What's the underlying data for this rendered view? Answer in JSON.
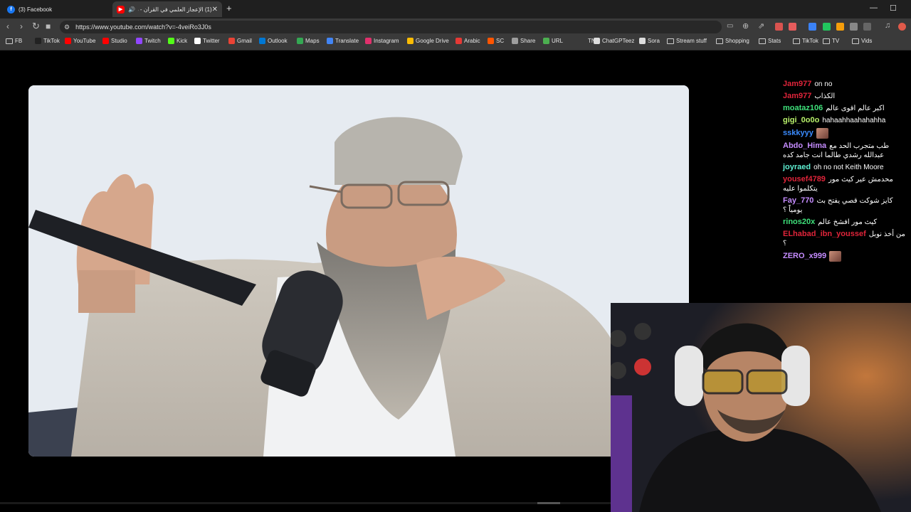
{
  "tabs": [
    {
      "title": "(3) Facebook",
      "favicon": "facebook-icon",
      "favicon_color": "#1877f2"
    },
    {
      "title": "(1) الإعجاز العلمي في القرآن - د",
      "favicon": "youtube-icon",
      "favicon_color": "#ff0000",
      "audio": "speaker-icon"
    }
  ],
  "window": {
    "minimize": "—",
    "maximize": "☐"
  },
  "address": {
    "url": "https://www.youtube.com/watch?v=-4veiRo3J0s"
  },
  "bookmarks": [
    {
      "label": "FB",
      "icon": "folder-icon",
      "color": "#cccccc"
    },
    {
      "label": "TikTok",
      "icon": "tiktok-icon",
      "color": "#222222"
    },
    {
      "label": "YouTube",
      "icon": "youtube-icon",
      "color": "#ff0000"
    },
    {
      "label": "Studio",
      "icon": "youtube-studio-icon",
      "color": "#ff0000"
    },
    {
      "label": "Twitch",
      "icon": "twitch-icon",
      "color": "#9146ff"
    },
    {
      "label": "Kick",
      "icon": "kick-icon",
      "color": "#53fc18"
    },
    {
      "label": "Twitter",
      "icon": "x-icon",
      "color": "#ffffff"
    },
    {
      "label": "Gmail",
      "icon": "gmail-icon",
      "color": "#ea4335"
    },
    {
      "label": "Outlook",
      "icon": "outlook-icon",
      "color": "#0078d4"
    },
    {
      "label": "Maps",
      "icon": "maps-icon",
      "color": "#34a853"
    },
    {
      "label": "Translate",
      "icon": "translate-icon",
      "color": "#4285f4"
    },
    {
      "label": "Instagram",
      "icon": "instagram-icon",
      "color": "#e1306c"
    },
    {
      "label": "Google Drive",
      "icon": "drive-icon",
      "color": "#fbbc04"
    },
    {
      "label": "Arabic",
      "icon": "arabic-icon",
      "color": "#e53935"
    },
    {
      "label": "SC",
      "icon": "soundcloud-icon",
      "color": "#ff5500"
    },
    {
      "label": "Share",
      "icon": "share-icon",
      "color": "#9e9e9e"
    },
    {
      "label": "URL",
      "icon": "url-icon",
      "color": "#4caf50"
    },
    {
      "label": "TN",
      "icon": "tn-icon",
      "color": "#3a3a3a"
    },
    {
      "label": "ChatGPTeez",
      "icon": "chatgpt-icon",
      "color": "#dddddd"
    },
    {
      "label": "Sora",
      "icon": "sora-icon",
      "color": "#dddddd"
    },
    {
      "label": "Stream stuff",
      "icon": "folder-icon",
      "color": "#cccccc"
    },
    {
      "label": "Shopping",
      "icon": "folder-icon",
      "color": "#cccccc"
    },
    {
      "label": "Stats",
      "icon": "folder-icon",
      "color": "#cccccc"
    },
    {
      "label": "TikTok",
      "icon": "folder-icon",
      "color": "#cccccc"
    },
    {
      "label": "TV",
      "icon": "folder-icon",
      "color": "#cccccc"
    },
    {
      "label": "Vids",
      "icon": "folder-icon",
      "color": "#cccccc"
    }
  ],
  "chat": [
    {
      "user": "Jam977",
      "color": "#e0243a",
      "text": "on no"
    },
    {
      "user": "Jam977",
      "color": "#e0243a",
      "text": "الكذاب"
    },
    {
      "user": "moataz106",
      "color": "#3ee07a",
      "text": "اكبر عالم اقوى عالم"
    },
    {
      "user": "gigi_0o0o",
      "color": "#b9f26b",
      "text": "hahaahhaahahahha"
    },
    {
      "user": "sskkyyy",
      "color": "#3b8cff",
      "text": "",
      "emote": "emote-icon"
    },
    {
      "user": "Abdo_Hima",
      "color": "#c58cff",
      "text": "طب متجرب الحد مع عبدالله رشدي طالما انت جامد كده"
    },
    {
      "user": "joyraed",
      "color": "#5ff0d3",
      "text": "oh no not Keith Moore"
    },
    {
      "user": "yousef4789",
      "color": "#e0243a",
      "text": "محدمش عير كيث مور يتكلموا عليه"
    },
    {
      "user": "Fay_770",
      "color": "#c58cff",
      "text": "كايز شوكت قصي يفتح بث يومياً ؟"
    },
    {
      "user": "rinos20x",
      "color": "#3ee07a",
      "text": "كيث مور افشخ عالم"
    },
    {
      "user": "ELhabad_ibn_youssef",
      "color": "#e0243a",
      "text": "من أخذ نوبل ؟"
    },
    {
      "user": "ZERO_x999",
      "color": "#c58cff",
      "text": "",
      "emote": "emote-icon"
    }
  ]
}
